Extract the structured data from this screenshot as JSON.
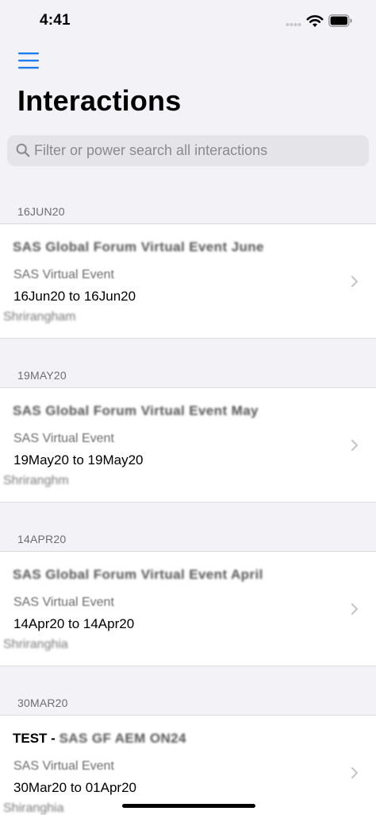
{
  "status_bar": {
    "time": "4:41"
  },
  "nav": {
    "menu_icon": "hamburger-menu-icon",
    "title": "Interactions"
  },
  "search": {
    "placeholder": "Filter or power search all interactions",
    "value": ""
  },
  "sections": [
    {
      "header": "16JUN20",
      "items": [
        {
          "title_prefix": "",
          "title": "SAS Global Forum Virtual Event June",
          "type": "SAS Virtual Event",
          "dates": "16Jun20 to 16Jun20",
          "host": "Shrirangham"
        }
      ]
    },
    {
      "header": "19MAY20",
      "items": [
        {
          "title_prefix": "",
          "title": "SAS Global Forum Virtual Event May",
          "type": "SAS Virtual Event",
          "dates": "19May20 to 19May20",
          "host": "Shriranghm"
        }
      ]
    },
    {
      "header": "14APR20",
      "items": [
        {
          "title_prefix": "",
          "title": "SAS Global Forum Virtual Event April",
          "type": "SAS Virtual Event",
          "dates": "14Apr20 to 14Apr20",
          "host": "Shriranghia"
        }
      ]
    },
    {
      "header": "30MAR20",
      "items": [
        {
          "title_prefix": "TEST - ",
          "title": "SAS GF AEM ON24",
          "type": "SAS Virtual Event",
          "dates": "30Mar20 to 01Apr20",
          "host": "Shiranghia"
        }
      ]
    }
  ],
  "colors": {
    "accent": "#1E7CF0",
    "background": "#F2F2F7",
    "secondary_text": "#6D6D72"
  }
}
